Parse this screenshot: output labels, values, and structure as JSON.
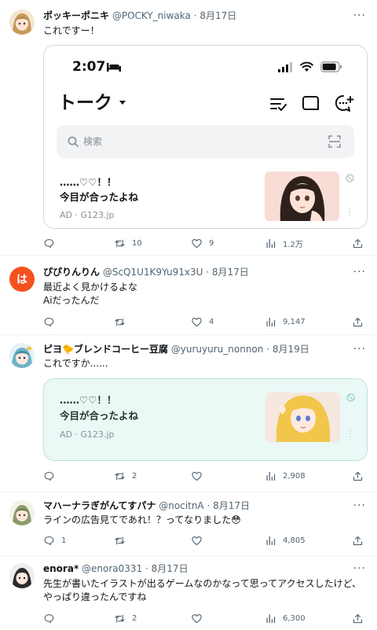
{
  "tweets": [
    {
      "name": "ポッキーポニキ",
      "handle": "@POCKY_niwaka",
      "date": "· 8月17日",
      "lines": [
        "これですー！"
      ],
      "counts": {
        "reply": "",
        "retweet": "10",
        "like": "9",
        "views": "1.2万"
      }
    },
    {
      "name": "ぴぴりんりん",
      "handle": "@ScQ1U1K9Yu91x3U",
      "date": "· 8月17日",
      "avatar_char": "は",
      "lines": [
        "最近よく見かけるよな",
        "Aiだったんだ"
      ],
      "counts": {
        "reply": "",
        "retweet": "",
        "like": "4",
        "views": "9,147"
      }
    },
    {
      "name": "ピヨ🐤ブレンドコーヒー豆腐",
      "handle": "@yuruyuru_nonnon",
      "date": "· 8月19日",
      "lines": [
        "これですか......"
      ],
      "counts": {
        "reply": "",
        "retweet": "2",
        "like": "",
        "views": "2,908"
      }
    },
    {
      "name": "マハーナラぎがんてすパナ",
      "handle": "@nocitnA",
      "date": "· 8月17日",
      "lines": [
        "ラインの広告見てであれ！？ってなりました😳"
      ],
      "counts": {
        "reply": "1",
        "retweet": "",
        "like": "",
        "views": "4,805"
      }
    },
    {
      "name": "enora*",
      "handle": "@enora0331",
      "date": "· 8月17日",
      "lines": [
        "先生が書いたイラストが出るゲームなのかなって思ってアクセスしたけど、",
        "やっぱり違ったんですね"
      ],
      "counts": {
        "reply": "",
        "retweet": "2",
        "like": "",
        "views": "6,300"
      }
    }
  ],
  "phone": {
    "time": "2:07",
    "screen_title": "トーク",
    "search_placeholder": "検索"
  },
  "ad": {
    "title_line1": "……♡♡！！",
    "title_line2": "今目が合ったよね",
    "source": "AD · G123.jp"
  },
  "colors": {
    "accent": "#1d9bf0",
    "text": "#0f1419",
    "muted": "#536471",
    "teal_card_bg": "#eaf8f6",
    "teal_card_border": "#b9e4dc",
    "avatar_orange": "#f4511e"
  }
}
